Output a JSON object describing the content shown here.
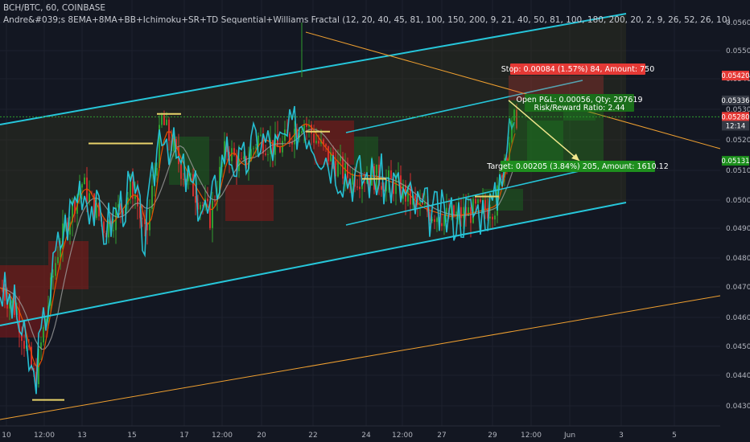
{
  "header": {
    "symbol_line": "BCH/BTC, 60, COINBASE",
    "indicator_line": "Andre&#039;s 8EMA+8MA+BB+Ichimoku+SR+TD Sequential+Williams Fractal (12, 20, 40, 45, 81, 100, 150, 200, 9, 21, 40, 50, 81, 100, 180, 200, 20, 2, 9, 26, 52, 26, 10)"
  },
  "colors": {
    "background": "#131722",
    "grid": "#1e222d",
    "channel": "#26c6da",
    "trendline": "#f0a030",
    "candle_up": "#2f9e2f",
    "candle_down": "#d32f2f",
    "cloud_red": "#8b1a1a",
    "cloud_green": "#1b5e20",
    "stop_box": "#e53935",
    "target_box": "#1e8e1e",
    "pnl_box": "#1a6e1a",
    "price_badge_red": "#e53935",
    "price_badge_green": "#1b8e1b",
    "price_badge_gray": "#363a45",
    "ma_orange": "#e65100",
    "ma_gray": "#9e9e9e"
  },
  "chart_data": {
    "type": "candlestick",
    "title": "BCH/BTC, 60, COINBASE",
    "x_ticks": [
      "10",
      "12:00",
      "13",
      "15",
      "17",
      "12:00",
      "20",
      "22",
      "24",
      "12:00",
      "27",
      "29",
      "12:00",
      "Jun",
      "3",
      "5"
    ],
    "y_ticks": [
      "0.05600",
      "0.05500",
      "0.05400",
      "0.05300",
      "0.05200",
      "0.05100",
      "0.05000",
      "0.04900",
      "0.04800",
      "0.04700",
      "0.04600",
      "0.04500",
      "0.04400",
      "0.04300"
    ],
    "ylim": [
      0.0425,
      0.057
    ],
    "price_badges": [
      {
        "label": "0.05420",
        "value": 0.0542,
        "kind": "red"
      },
      {
        "label": "0.05336",
        "value": 0.05336,
        "kind": "gray"
      },
      {
        "label": "0.05280",
        "value": 0.0528,
        "kind": "red"
      },
      {
        "label": "12:14",
        "value": 0.0525,
        "kind": "gray"
      },
      {
        "label": "0.05131",
        "value": 0.05131,
        "kind": "green"
      }
    ],
    "position": {
      "stop_text": "Stop: 0.00084 (1.57%) 84, Amount: 750",
      "pnl_line1": "Open P&L: 0.00056, Qty: 297619",
      "pnl_line2": "Risk/Reward Ratio: 2.44",
      "target_text": "Target: 0.00205 (3.84%) 205, Amount: 1610.12",
      "stop": 0.0542,
      "entry": 0.05336,
      "target": 0.05131
    },
    "current_price": 0.0528
  }
}
